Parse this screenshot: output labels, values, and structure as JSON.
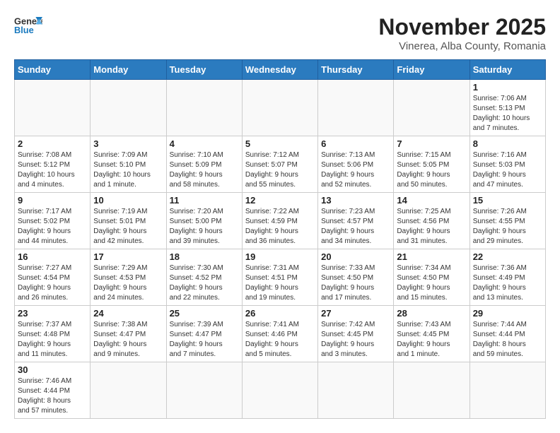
{
  "header": {
    "logo_line1": "General",
    "logo_line2": "Blue",
    "month": "November 2025",
    "location": "Vinerea, Alba County, Romania"
  },
  "weekdays": [
    "Sunday",
    "Monday",
    "Tuesday",
    "Wednesday",
    "Thursday",
    "Friday",
    "Saturday"
  ],
  "weeks": [
    [
      {
        "day": "",
        "info": ""
      },
      {
        "day": "",
        "info": ""
      },
      {
        "day": "",
        "info": ""
      },
      {
        "day": "",
        "info": ""
      },
      {
        "day": "",
        "info": ""
      },
      {
        "day": "",
        "info": ""
      },
      {
        "day": "1",
        "info": "Sunrise: 7:06 AM\nSunset: 5:13 PM\nDaylight: 10 hours\nand 7 minutes."
      }
    ],
    [
      {
        "day": "2",
        "info": "Sunrise: 7:08 AM\nSunset: 5:12 PM\nDaylight: 10 hours\nand 4 minutes."
      },
      {
        "day": "3",
        "info": "Sunrise: 7:09 AM\nSunset: 5:10 PM\nDaylight: 10 hours\nand 1 minute."
      },
      {
        "day": "4",
        "info": "Sunrise: 7:10 AM\nSunset: 5:09 PM\nDaylight: 9 hours\nand 58 minutes."
      },
      {
        "day": "5",
        "info": "Sunrise: 7:12 AM\nSunset: 5:07 PM\nDaylight: 9 hours\nand 55 minutes."
      },
      {
        "day": "6",
        "info": "Sunrise: 7:13 AM\nSunset: 5:06 PM\nDaylight: 9 hours\nand 52 minutes."
      },
      {
        "day": "7",
        "info": "Sunrise: 7:15 AM\nSunset: 5:05 PM\nDaylight: 9 hours\nand 50 minutes."
      },
      {
        "day": "8",
        "info": "Sunrise: 7:16 AM\nSunset: 5:03 PM\nDaylight: 9 hours\nand 47 minutes."
      }
    ],
    [
      {
        "day": "9",
        "info": "Sunrise: 7:17 AM\nSunset: 5:02 PM\nDaylight: 9 hours\nand 44 minutes."
      },
      {
        "day": "10",
        "info": "Sunrise: 7:19 AM\nSunset: 5:01 PM\nDaylight: 9 hours\nand 42 minutes."
      },
      {
        "day": "11",
        "info": "Sunrise: 7:20 AM\nSunset: 5:00 PM\nDaylight: 9 hours\nand 39 minutes."
      },
      {
        "day": "12",
        "info": "Sunrise: 7:22 AM\nSunset: 4:59 PM\nDaylight: 9 hours\nand 36 minutes."
      },
      {
        "day": "13",
        "info": "Sunrise: 7:23 AM\nSunset: 4:57 PM\nDaylight: 9 hours\nand 34 minutes."
      },
      {
        "day": "14",
        "info": "Sunrise: 7:25 AM\nSunset: 4:56 PM\nDaylight: 9 hours\nand 31 minutes."
      },
      {
        "day": "15",
        "info": "Sunrise: 7:26 AM\nSunset: 4:55 PM\nDaylight: 9 hours\nand 29 minutes."
      }
    ],
    [
      {
        "day": "16",
        "info": "Sunrise: 7:27 AM\nSunset: 4:54 PM\nDaylight: 9 hours\nand 26 minutes."
      },
      {
        "day": "17",
        "info": "Sunrise: 7:29 AM\nSunset: 4:53 PM\nDaylight: 9 hours\nand 24 minutes."
      },
      {
        "day": "18",
        "info": "Sunrise: 7:30 AM\nSunset: 4:52 PM\nDaylight: 9 hours\nand 22 minutes."
      },
      {
        "day": "19",
        "info": "Sunrise: 7:31 AM\nSunset: 4:51 PM\nDaylight: 9 hours\nand 19 minutes."
      },
      {
        "day": "20",
        "info": "Sunrise: 7:33 AM\nSunset: 4:50 PM\nDaylight: 9 hours\nand 17 minutes."
      },
      {
        "day": "21",
        "info": "Sunrise: 7:34 AM\nSunset: 4:50 PM\nDaylight: 9 hours\nand 15 minutes."
      },
      {
        "day": "22",
        "info": "Sunrise: 7:36 AM\nSunset: 4:49 PM\nDaylight: 9 hours\nand 13 minutes."
      }
    ],
    [
      {
        "day": "23",
        "info": "Sunrise: 7:37 AM\nSunset: 4:48 PM\nDaylight: 9 hours\nand 11 minutes."
      },
      {
        "day": "24",
        "info": "Sunrise: 7:38 AM\nSunset: 4:47 PM\nDaylight: 9 hours\nand 9 minutes."
      },
      {
        "day": "25",
        "info": "Sunrise: 7:39 AM\nSunset: 4:47 PM\nDaylight: 9 hours\nand 7 minutes."
      },
      {
        "day": "26",
        "info": "Sunrise: 7:41 AM\nSunset: 4:46 PM\nDaylight: 9 hours\nand 5 minutes."
      },
      {
        "day": "27",
        "info": "Sunrise: 7:42 AM\nSunset: 4:45 PM\nDaylight: 9 hours\nand 3 minutes."
      },
      {
        "day": "28",
        "info": "Sunrise: 7:43 AM\nSunset: 4:45 PM\nDaylight: 9 hours\nand 1 minute."
      },
      {
        "day": "29",
        "info": "Sunrise: 7:44 AM\nSunset: 4:44 PM\nDaylight: 8 hours\nand 59 minutes."
      }
    ],
    [
      {
        "day": "30",
        "info": "Sunrise: 7:46 AM\nSunset: 4:44 PM\nDaylight: 8 hours\nand 57 minutes."
      },
      {
        "day": "",
        "info": ""
      },
      {
        "day": "",
        "info": ""
      },
      {
        "day": "",
        "info": ""
      },
      {
        "day": "",
        "info": ""
      },
      {
        "day": "",
        "info": ""
      },
      {
        "day": "",
        "info": ""
      }
    ]
  ]
}
